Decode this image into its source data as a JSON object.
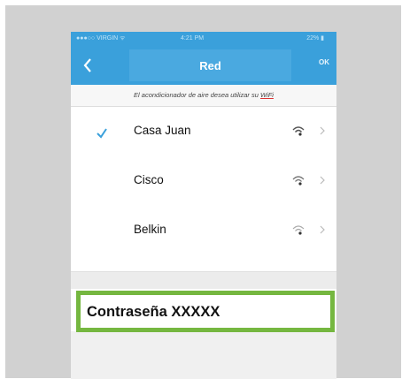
{
  "status_bar": {
    "carrier": "●●●○○ VIRGIN ᯤ",
    "time": "4:21 PM",
    "battery": "22% ▮"
  },
  "nav": {
    "title": "Red",
    "ok_label": "OK"
  },
  "prompt": {
    "text": "El acondicionador de aire desea utilizar su ",
    "wifi": "WiFi"
  },
  "networks": [
    {
      "name": "Casa Juan",
      "selected": true
    },
    {
      "name": "Cisco",
      "selected": false
    },
    {
      "name": "Belkin",
      "selected": false
    }
  ],
  "password": {
    "label": "Contraseña XXXXX"
  },
  "colors": {
    "accent": "#3aa0db",
    "highlight": "#75b740"
  }
}
